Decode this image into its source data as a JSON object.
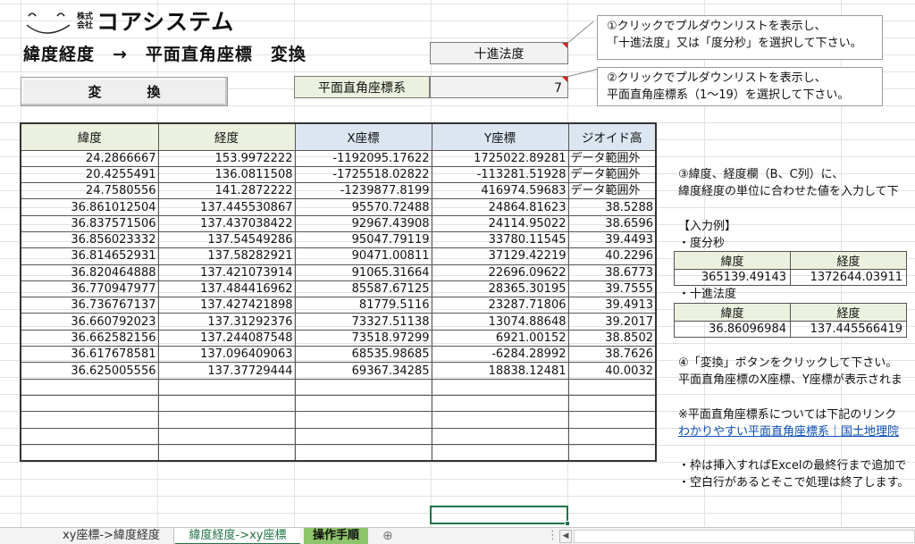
{
  "logo": {
    "face_text": "ニコッと笑顔、アイシテル",
    "kabushiki": "株式会社",
    "company": "コアシステム"
  },
  "page_title": "緯度経度　→　平面直角座標　変換",
  "convert_button": "変　換",
  "format_select": {
    "value": "十進法度"
  },
  "coord_system": {
    "label": "平面直角座標系",
    "value": "7"
  },
  "callouts": [
    {
      "line1": "①クリックでプルダウンリストを表示し、",
      "line2": "「十進法度」又は「度分秒」を選択して下さい。"
    },
    {
      "line1": "②クリックでプルダウンリストを表示し、",
      "line2": "平面直角座標系（1～19）を選択して下さい。"
    }
  ],
  "table": {
    "headers": [
      "緯度",
      "経度",
      "X座標",
      "Y座標",
      "ジオイド高"
    ],
    "rows": [
      [
        "24.2866667",
        "153.9972222",
        "-1192095.17622",
        "1725022.89281",
        "データ範囲外"
      ],
      [
        "20.4255491",
        "136.0811508",
        "-1725518.02822",
        "-113281.51928",
        "データ範囲外"
      ],
      [
        "24.7580556",
        "141.2872222",
        "-1239877.8199",
        "416974.59683",
        "データ範囲外"
      ],
      [
        "36.861012504",
        "137.445530867",
        "95570.72488",
        "24864.81623",
        "38.5288"
      ],
      [
        "36.837571506",
        "137.437038422",
        "92967.43908",
        "24114.95022",
        "38.6596"
      ],
      [
        "36.856023332",
        "137.54549286",
        "95047.79119",
        "33780.11545",
        "39.4493"
      ],
      [
        "36.814652931",
        "137.58282921",
        "90471.00811",
        "37129.42219",
        "40.2296"
      ],
      [
        "36.820464888",
        "137.421073914",
        "91065.31664",
        "22696.09622",
        "38.6773"
      ],
      [
        "36.770947977",
        "137.484416962",
        "85587.67125",
        "28365.30195",
        "39.7555"
      ],
      [
        "36.736767137",
        "137.427421898",
        "81779.5116",
        "23287.71806",
        "39.4913"
      ],
      [
        "36.660792023",
        "137.31292376",
        "73327.51138",
        "13074.88648",
        "39.2017"
      ],
      [
        "36.662582156",
        "137.244087548",
        "73518.97299",
        "6921.00152",
        "38.8502"
      ],
      [
        "36.617678581",
        "137.096409063",
        "68535.98685",
        "-6284.28992",
        "38.7626"
      ],
      [
        "36.625005556",
        "137.37729444",
        "69367.34285",
        "18838.12481",
        "40.0032"
      ],
      [
        "",
        "",
        "",
        "",
        ""
      ],
      [
        "",
        "",
        "",
        "",
        ""
      ],
      [
        "",
        "",
        "",
        "",
        ""
      ],
      [
        "",
        "",
        "",
        "",
        ""
      ],
      [
        "",
        "",
        "",
        "",
        ""
      ]
    ]
  },
  "instructions": {
    "step3_line1": "③緯度、経度欄（B、C列）に、",
    "step3_line2": "緯度経度の単位に合わせた値を入力して下",
    "example_heading": "【入力例】",
    "dms_label": "・度分秒",
    "dms_headers": [
      "緯度",
      "経度"
    ],
    "dms_values": [
      "365139.49143",
      "1372644.03911"
    ],
    "dec_label": "・十進法度",
    "dec_headers": [
      "緯度",
      "経度"
    ],
    "dec_values": [
      "36.86096984",
      "137.445566419"
    ],
    "step4_line1": "④「変換」ボタンをクリックして下さい。",
    "step4_line2": "平面直角座標のX座標、Y座標が表示されま",
    "note_line": "※平面直角座標系については下記のリンク",
    "link_text": "わかりやすい平面直角座標系｜国土地理院",
    "bullet1": "・枠は挿入すればExcelの最終行まで追加で",
    "bullet2": "・空白行があるとそこで処理は終了します。"
  },
  "sheet_tabs": {
    "tab1": "xy座標->緯度経度",
    "tab2": "緯度経度->xy座標",
    "tab3": "操作手順",
    "add": "⊕",
    "dots": "⋮",
    "scroll_left": "◀"
  },
  "colors": {
    "header_green": "#ebf1de",
    "header_blue": "#dce6f1",
    "excel_green": "#217346",
    "tab_highlight": "#8fc56b",
    "link_blue": "#0b4eb6",
    "dropdown_marker": "#e0241b"
  },
  "icons": [
    "smiley-icon",
    "dropdown-marker-icon",
    "add-sheet-icon",
    "scroll-left-icon"
  ]
}
